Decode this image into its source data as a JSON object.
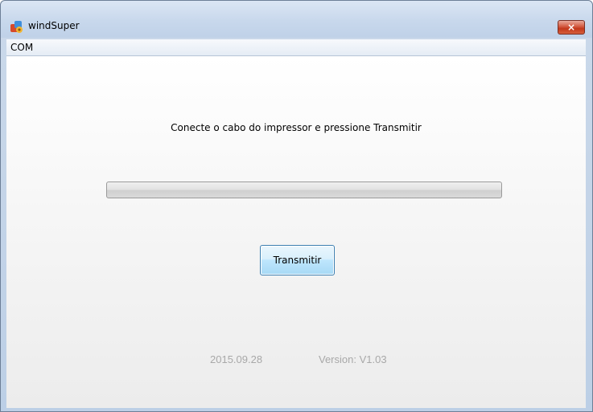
{
  "window": {
    "title": "windSuper",
    "close_symbol": "×",
    "icon": "app-icon"
  },
  "menu": {
    "items": [
      {
        "label": "COM"
      }
    ]
  },
  "main": {
    "instruction": "Conecte o cabo do impressor e pressione Transmitir",
    "progress": {
      "value": 0
    },
    "transmit_label": "Transmitir",
    "footer": {
      "date": "2015.09.28",
      "version": "Version: V1.03"
    }
  },
  "colors": {
    "titlebar": "#c8d8ec",
    "close_button": "#c2381b",
    "button_border": "#3c7fb1",
    "footer_text": "#a8a8a8"
  }
}
